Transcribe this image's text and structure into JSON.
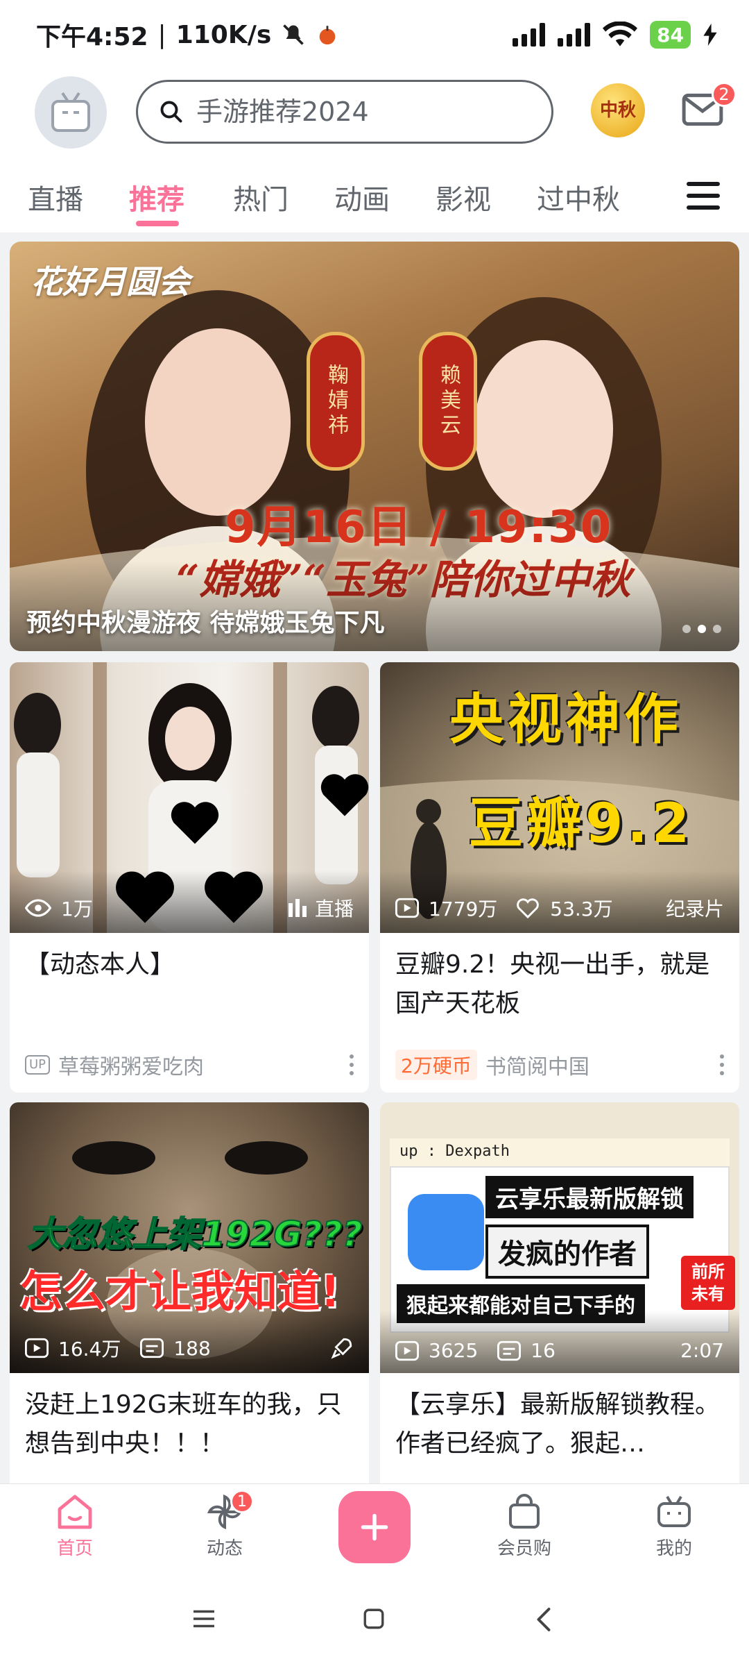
{
  "status_bar": {
    "time": "下午4:52",
    "net_speed": "110K/s",
    "battery": "84"
  },
  "header": {
    "search_placeholder": "手游推荐2024",
    "festival_badge": "中秋",
    "mail_count": "2"
  },
  "tabs": [
    {
      "label": "直播"
    },
    {
      "label": "推荐"
    },
    {
      "label": "热门"
    },
    {
      "label": "动画"
    },
    {
      "label": "影视"
    },
    {
      "label": "过中秋"
    }
  ],
  "active_tab_index": 1,
  "banner": {
    "logo_text": "花好月圆会",
    "name_left": "鞠婧祎",
    "name_right": "赖美云",
    "date_text": "9月16日 / 19:30",
    "slogan": "“嫦娥”“玉兔”陪你过中秋",
    "caption": "预约中秋漫游夜 待嫦娥玉兔下凡",
    "slide_count": 3,
    "active_slide": 1
  },
  "cards": [
    {
      "views": "1万",
      "right_label": "直播",
      "title": "【动态本人】",
      "up_tag": "UP",
      "author": "草莓粥粥爱吃肉"
    },
    {
      "thumb_text_1": "央视神作",
      "thumb_text_2": "豆瓣9.2",
      "views": "1779万",
      "likes": "53.3万",
      "right_label": "纪录片",
      "title": "豆瓣9.2！央视一出手，就是国产天花板",
      "coin_tag": "2万硬币",
      "author": "书简阅中国"
    },
    {
      "thumb_text_1": "大忽悠上架192G???",
      "thumb_text_2": "怎么才让我知道!",
      "views": "16.4万",
      "comments": "188",
      "title": "没赶上192G末班车的我，只想告到中央！！！"
    },
    {
      "thumb_header": "up : Dexpath",
      "thumb_line_1": "云享乐最新版解锁",
      "thumb_line_2": "发疯的作者",
      "thumb_badge_1": "前所",
      "thumb_badge_2": "未有",
      "thumb_line_3": "狠起来都能对自己下手的",
      "views": "3625",
      "comments": "16",
      "duration": "2:07",
      "title": "【云享乐】最新版解锁教程。作者已经疯了。狠起…"
    }
  ],
  "bottom_nav": {
    "home": "首页",
    "dynamic": "动态",
    "dynamic_badge": "1",
    "vip": "会员购",
    "mine": "我的"
  },
  "colors": {
    "accent": "#fb7299",
    "badge_red": "#fb5a5a",
    "text_secondary": "#9499a0"
  }
}
